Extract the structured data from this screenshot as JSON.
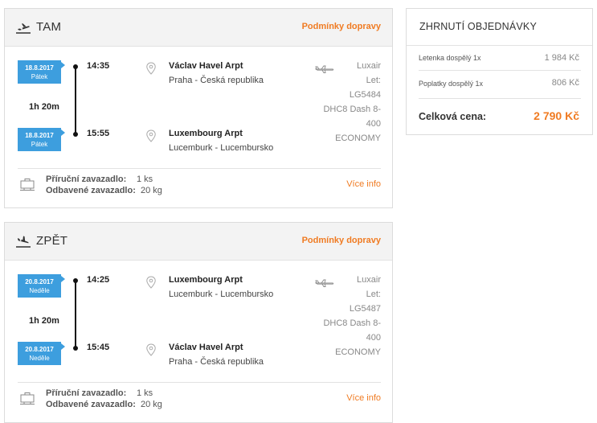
{
  "outbound": {
    "title": "TAM",
    "conditions_link": "Podmínky dopravy",
    "departure": {
      "date": "18.8.2017",
      "weekday": "Pátek",
      "time": "14:35",
      "airport": "Václav Havel Arpt",
      "city": "Praha - Česká republika"
    },
    "duration": "1h 20m",
    "arrival": {
      "date": "18.8.2017",
      "weekday": "Pátek",
      "time": "15:55",
      "airport": "Luxembourg Arpt",
      "city": "Lucemburk - Lucembursko"
    },
    "flight": {
      "airline": "Luxair",
      "flight_label": "Let:",
      "flight_no": "LG5484",
      "aircraft_line1": "DHC8 Dash 8-",
      "aircraft_line2": "400",
      "class": "ECONOMY"
    },
    "baggage": {
      "hand_label": "Příruční zavazadlo:",
      "hand_value": "1 ks",
      "checked_label": "Odbavené zavazadlo:",
      "checked_value": "20 kg"
    },
    "more_link": "Více info"
  },
  "return": {
    "title": "ZPĚT",
    "conditions_link": "Podmínky dopravy",
    "departure": {
      "date": "20.8.2017",
      "weekday": "Neděle",
      "time": "14:25",
      "airport": "Luxembourg Arpt",
      "city": "Lucemburk - Lucembursko"
    },
    "duration": "1h 20m",
    "arrival": {
      "date": "20.8.2017",
      "weekday": "Neděle",
      "time": "15:45",
      "airport": "Václav Havel Arpt",
      "city": "Praha - Česká republika"
    },
    "flight": {
      "airline": "Luxair",
      "flight_label": "Let:",
      "flight_no": "LG5487",
      "aircraft_line1": "DHC8 Dash 8-",
      "aircraft_line2": "400",
      "class": "ECONOMY"
    },
    "baggage": {
      "hand_label": "Příruční zavazadlo:",
      "hand_value": "1 ks",
      "checked_label": "Odbavené zavazadlo:",
      "checked_value": "20 kg"
    },
    "more_link": "Více info"
  },
  "summary": {
    "title": "ZHRNUTÍ OBJEDNÁVKY",
    "rows": [
      {
        "label": "Letenka dospělý 1x",
        "value": "1 984 Kč"
      },
      {
        "label": "Poplatky dospělý 1x",
        "value": "806 Kč"
      }
    ],
    "total_label": "Celková cena:",
    "total_value": "2 790 Kč"
  },
  "colors": {
    "accent": "#f07b22",
    "date_badge": "#3d9ede",
    "header_bg": "#f3f3f3"
  },
  "icons": {
    "outbound": "takeoff-icon",
    "return": "landing-icon",
    "location": "location-pin-icon",
    "aircraft": "airplane-icon",
    "baggage": "luggage-icon"
  }
}
